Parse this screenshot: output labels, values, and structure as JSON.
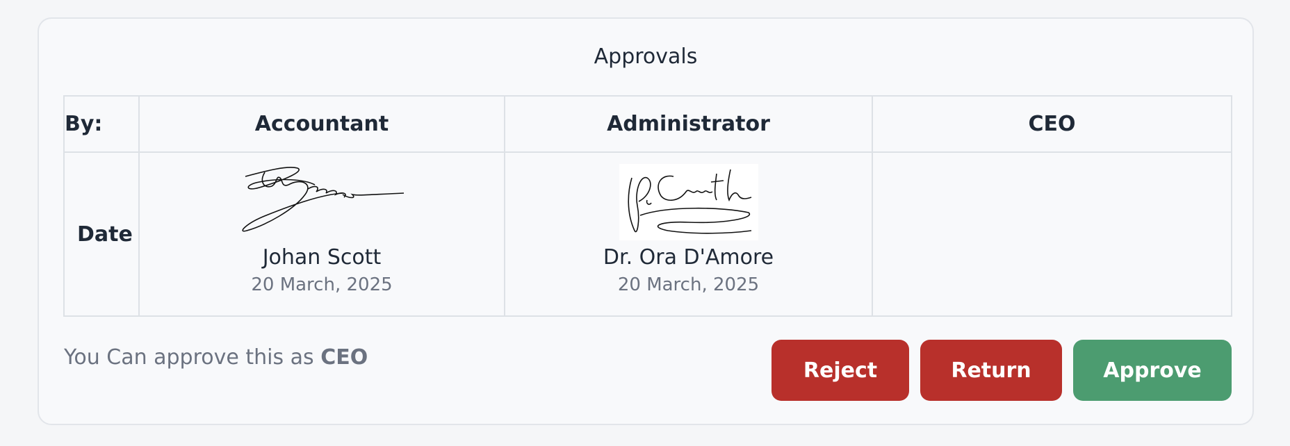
{
  "panel": {
    "title": "Approvals",
    "row_header_by": "By:",
    "row_header_date": "Date",
    "columns": [
      "Accountant",
      "Administrator",
      "CEO"
    ],
    "approvals": [
      {
        "role": "Accountant",
        "name": "Johan Scott",
        "date": "20 March, 2025"
      },
      {
        "role": "Administrator",
        "name": "Dr. Ora D'Amore",
        "date": "20 March, 2025"
      },
      {
        "role": "CEO",
        "name": "",
        "date": ""
      }
    ]
  },
  "footer": {
    "note_prefix": "You Can approve this as",
    "note_role": "CEO",
    "buttons": {
      "reject": "Reject",
      "return": "Return",
      "approve": "Approve"
    },
    "colors": {
      "reject": "#b8302b",
      "return": "#b8302b",
      "approve": "#4c9c70"
    }
  }
}
